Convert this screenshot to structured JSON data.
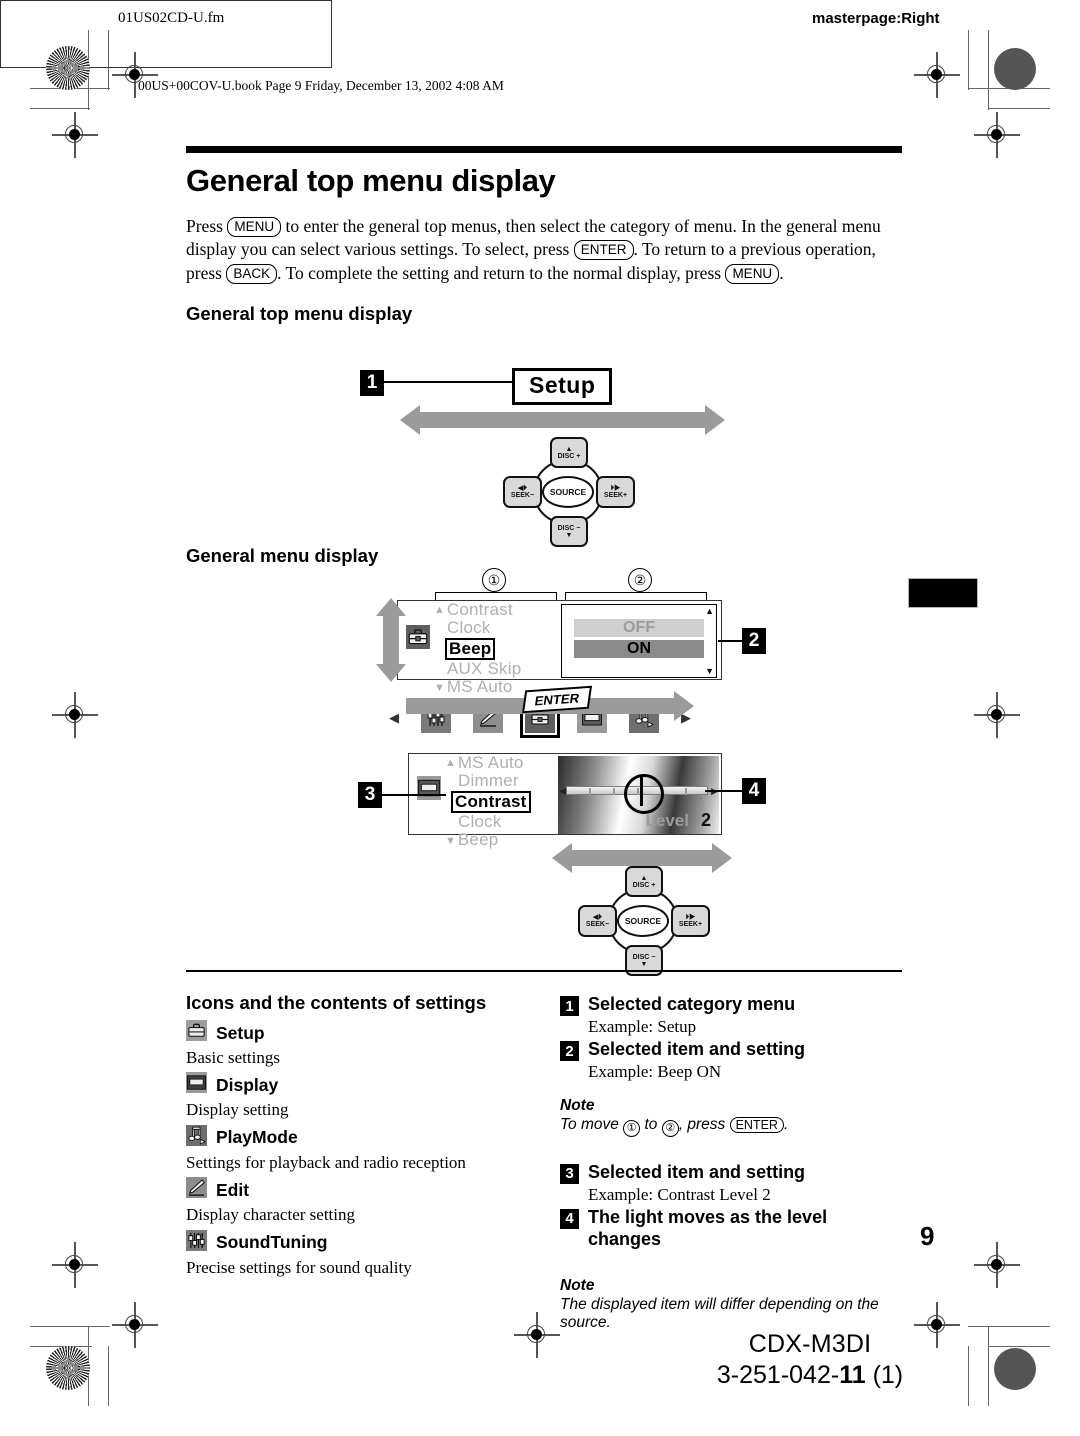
{
  "header": {
    "file_name": "01US02CD-U.fm",
    "masterpage": "masterpage:Right",
    "book_line": "00US+00COV-U.book  Page 9  Friday, December 13, 2002  4:08 AM"
  },
  "title": "General top menu display",
  "intro": {
    "p1": "Press",
    "key_menu": "MENU",
    "p2": "to enter the general top menus, then select the category of menu. In the general menu display you can select various settings. To select, press",
    "key_enter": "ENTER",
    "p3": ". To return to a previous operation, press",
    "key_back": "BACK",
    "p4": ". To complete the setting and return to the normal display, press",
    "key_menu2": "MENU",
    "p5": "."
  },
  "section_top_menu": {
    "heading": "General top menu display",
    "icons": [
      {
        "name": "soundtuning-icon",
        "label": "SoundTuning"
      },
      {
        "name": "edit-icon",
        "label": "Edit"
      },
      {
        "name": "setup-icon",
        "label": "Setup"
      },
      {
        "name": "display-icon",
        "label": "Display"
      },
      {
        "name": "playmode-icon",
        "label": "PlayMode"
      }
    ],
    "selected_label": "Setup",
    "callout": "1",
    "nav_left_glyph": "◀",
    "nav_right_glyph": "▶"
  },
  "joystick": {
    "center": "SOURCE",
    "up": "DISC +",
    "down": "DISC −",
    "left": "SEEK−",
    "right": "SEEK+"
  },
  "section_menu_display": {
    "heading": "General menu display",
    "marker_1": "①",
    "marker_2": "②",
    "callout": "2",
    "items": [
      {
        "label": "Contrast",
        "selected": false
      },
      {
        "label": "Clock",
        "selected": false
      },
      {
        "label": "Beep",
        "selected": true
      },
      {
        "label": "AUX Skip",
        "selected": false
      },
      {
        "label": "MS Auto",
        "selected": false
      }
    ],
    "values": [
      {
        "label": "OFF",
        "selected": false
      },
      {
        "label": "ON",
        "selected": true
      }
    ],
    "enter_label": "ENTER"
  },
  "section_level_display": {
    "callout_left": "3",
    "callout_right": "4",
    "items": [
      {
        "label": "MS  Auto",
        "selected": false
      },
      {
        "label": "Dimmer",
        "selected": false
      },
      {
        "label": "Contrast",
        "selected": true
      },
      {
        "label": "Clock",
        "selected": false
      },
      {
        "label": "Beep",
        "selected": false
      }
    ],
    "level_label": "Level",
    "level_value": "2",
    "slider_minus": "−",
    "slider_plus": "+"
  },
  "icons_section": {
    "heading": "Icons and the contents of settings",
    "entries": [
      {
        "icon": "setup-icon",
        "name": "Setup",
        "desc": "Basic settings"
      },
      {
        "icon": "display-icon",
        "name": "Display",
        "desc": "Display setting"
      },
      {
        "icon": "playmode-icon",
        "name": "PlayMode",
        "desc": "Settings for playback and radio reception"
      },
      {
        "icon": "edit-icon",
        "name": "Edit",
        "desc": "Display character setting"
      },
      {
        "icon": "soundtuning-icon",
        "name": "SoundTuning",
        "desc": "Precise settings for sound quality"
      }
    ]
  },
  "legend": {
    "item1": {
      "num": "1",
      "label": "Selected category menu",
      "example": "Example: Setup"
    },
    "item2": {
      "num": "2",
      "label": "Selected item and setting",
      "example": "Example: Beep ON"
    },
    "note1": {
      "head": "Note",
      "pre": "To move",
      "c1": "①",
      "mid": "to",
      "c2": "②",
      "post": ", press",
      "key": "ENTER",
      "end": "."
    },
    "item3": {
      "num": "3",
      "label": "Selected item and setting",
      "example": "Example: Contrast Level 2"
    },
    "item4": {
      "num": "4",
      "label": "The light moves as the level changes"
    },
    "note2": {
      "head": "Note",
      "body": "The displayed item will differ depending on the source."
    }
  },
  "page_number": "9",
  "footer": {
    "model": "CDX-M3DI",
    "code_prefix": "3-251-042-",
    "code_bold": "11",
    "code_suffix": " (1)"
  }
}
